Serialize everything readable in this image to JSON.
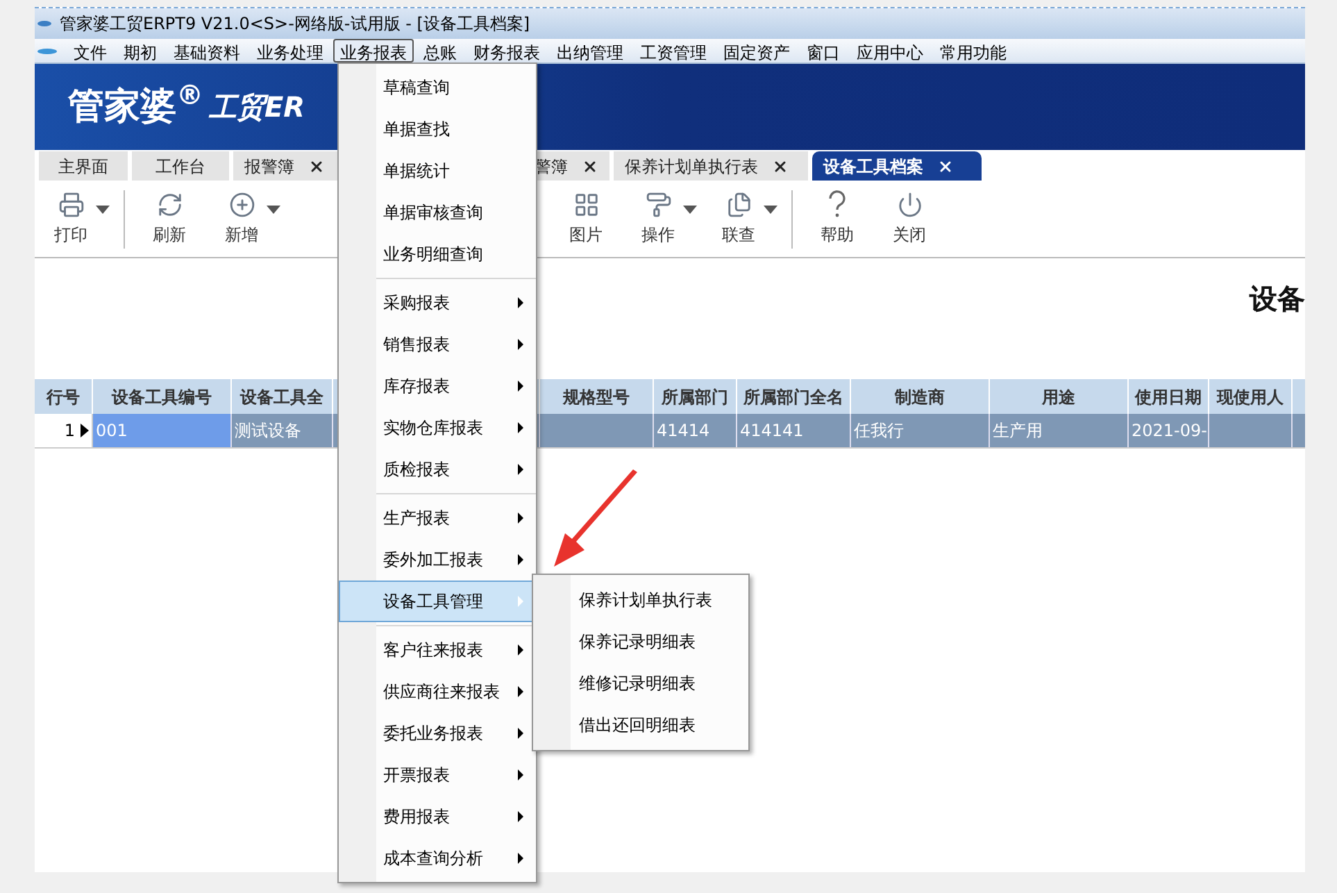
{
  "window": {
    "title": "管家婆工贸ERPT9 V21.0<S>-网络版-试用版 - [设备工具档案]"
  },
  "menubar": [
    {
      "label": "文件",
      "selected": false
    },
    {
      "label": "期初",
      "selected": false
    },
    {
      "label": "基础资料",
      "selected": false
    },
    {
      "label": "业务处理",
      "selected": false
    },
    {
      "label": "业务报表",
      "selected": true
    },
    {
      "label": "总账",
      "selected": false
    },
    {
      "label": "财务报表",
      "selected": false
    },
    {
      "label": "出纳管理",
      "selected": false
    },
    {
      "label": "工资管理",
      "selected": false
    },
    {
      "label": "固定资产",
      "selected": false
    },
    {
      "label": "窗口",
      "selected": false
    },
    {
      "label": "应用中心",
      "selected": false
    },
    {
      "label": "常用功能",
      "selected": false
    }
  ],
  "banner": {
    "logo": "管家婆$^{®}$",
    "logo_suffix": "工贸ER"
  },
  "tabs": [
    {
      "label": "主界面",
      "closable": false,
      "selected": false
    },
    {
      "label": "工作台",
      "closable": false,
      "selected": false
    },
    {
      "label": "报警簿",
      "closable": true,
      "selected": false
    },
    {
      "label": "警簿",
      "closable": true,
      "selected": false
    },
    {
      "label": "保养计划单执行表",
      "closable": true,
      "selected": false
    },
    {
      "label": "设备工具档案",
      "closable": true,
      "selected": true
    }
  ],
  "toolbar": {
    "left": [
      {
        "kind": "print",
        "label": "打印",
        "dropdown": true
      },
      {
        "kind": "refresh",
        "label": "刷新",
        "dropdown": false
      },
      {
        "kind": "add",
        "label": "新增",
        "dropdown": true
      }
    ],
    "right": [
      {
        "kind": "image",
        "label": "图片",
        "dropdown": false
      },
      {
        "kind": "operate",
        "label": "操作",
        "dropdown": true
      },
      {
        "kind": "linked",
        "label": "联查",
        "dropdown": true
      },
      {
        "kind": "help",
        "label": "帮助",
        "dropdown": false
      },
      {
        "kind": "close",
        "label": "关闭",
        "dropdown": false
      }
    ]
  },
  "page_title": "设备",
  "table": {
    "columns": [
      "行号",
      "设备工具编号",
      "设备工具全",
      "规格型号",
      "所属部门",
      "所属部门全名",
      "制造商",
      "用途",
      "使用日期",
      "现使用人"
    ],
    "rows": [
      {
        "selected": true,
        "cells": [
          "1",
          "001",
          "测试设备",
          "",
          "41414",
          "414141",
          "任我行",
          "生产用",
          "2021-09-",
          ""
        ]
      }
    ]
  },
  "menu": {
    "groups": [
      [
        {
          "label": "草稿查询",
          "submenu": false,
          "selected": false
        },
        {
          "label": "单据查找",
          "submenu": false,
          "selected": false
        },
        {
          "label": "单据统计",
          "submenu": false,
          "selected": false
        },
        {
          "label": "单据审核查询",
          "submenu": false,
          "selected": false
        },
        {
          "label": "业务明细查询",
          "submenu": false,
          "selected": false
        }
      ],
      [
        {
          "label": "采购报表",
          "submenu": true,
          "selected": false
        },
        {
          "label": "销售报表",
          "submenu": true,
          "selected": false
        },
        {
          "label": "库存报表",
          "submenu": true,
          "selected": false
        },
        {
          "label": "实物仓库报表",
          "submenu": true,
          "selected": false
        },
        {
          "label": "质检报表",
          "submenu": true,
          "selected": false
        }
      ],
      [
        {
          "label": "生产报表",
          "submenu": true,
          "selected": false
        },
        {
          "label": "委外加工报表",
          "submenu": true,
          "selected": false
        },
        {
          "label": "设备工具管理",
          "submenu": true,
          "selected": true
        }
      ],
      [
        {
          "label": "客户往来报表",
          "submenu": true,
          "selected": false
        },
        {
          "label": "供应商往来报表",
          "submenu": true,
          "selected": false
        },
        {
          "label": "委托业务报表",
          "submenu": true,
          "selected": false
        },
        {
          "label": "开票报表",
          "submenu": true,
          "selected": false
        },
        {
          "label": "费用报表",
          "submenu": true,
          "selected": false
        },
        {
          "label": "成本查询分析",
          "submenu": true,
          "selected": false
        }
      ]
    ]
  },
  "submenu": {
    "items": [
      {
        "label": "保养计划单执行表"
      },
      {
        "label": "保养记录明细表"
      },
      {
        "label": "维修记录明细表"
      },
      {
        "label": "借出还回明细表"
      }
    ]
  }
}
